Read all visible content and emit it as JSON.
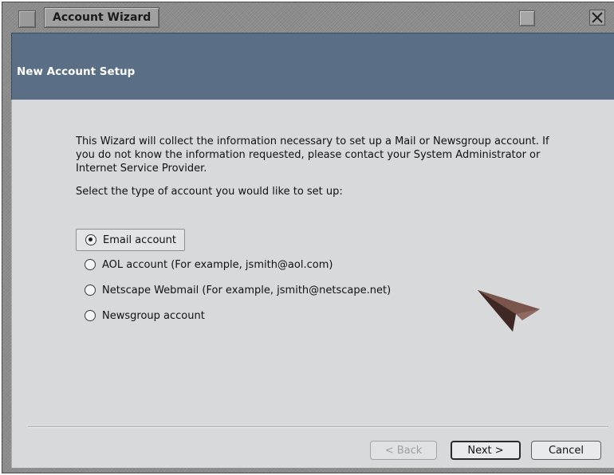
{
  "window": {
    "title": "Account Wizard"
  },
  "header": {
    "title": "New Account Setup"
  },
  "body": {
    "intro": "This Wizard will collect the information necessary to set up a Mail or Newsgroup account. If you do not know the information requested, please contact your System Administrator or Internet Service Provider.",
    "prompt": "Select the type of account you would like to set up:",
    "options": [
      {
        "label": "Email account",
        "selected": true
      },
      {
        "label": "AOL account (For example, jsmith@aol.com)",
        "selected": false
      },
      {
        "label": "Netscape Webmail (For example, jsmith@netscape.net)",
        "selected": false
      },
      {
        "label": "Newsgroup account",
        "selected": false
      }
    ]
  },
  "footer": {
    "back_label": "< Back",
    "next_label": "Next >",
    "cancel_label": "Cancel"
  },
  "icons": {
    "system_menu": "window-menu-icon",
    "maximize": "maximize-icon",
    "close": "close-icon",
    "decoration": "paper-plane-arrow-icon"
  },
  "colors": {
    "header_band": "#5a6e85",
    "content_bg": "#d7d9db",
    "chrome": "#8f8f8f"
  }
}
